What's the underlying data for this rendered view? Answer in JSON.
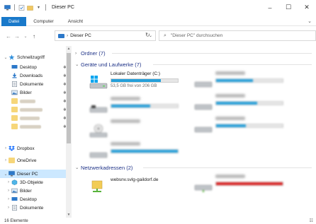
{
  "window": {
    "title": "Dieser PC",
    "controls": {
      "minimize": "–",
      "maximize": "☐",
      "close": "✕"
    }
  },
  "ribbon": {
    "tabs": [
      "Datei",
      "Computer",
      "Ansicht"
    ],
    "expand": "⌄"
  },
  "nav": {
    "back": "←",
    "forward": "→",
    "recent": "⌄",
    "up": "↑",
    "address": "Dieser PC",
    "address_sep": "›",
    "address_dropdown": "⌄",
    "refresh": "↻",
    "search_placeholder": "\"Dieser PC\" durchsuchen"
  },
  "sidebar": {
    "quick_access": "Schnellzugriff",
    "items": [
      {
        "label": "Desktop",
        "icon": "desktop-icon",
        "pinned": true
      },
      {
        "label": "Downloads",
        "icon": "download-icon",
        "pinned": true
      },
      {
        "label": "Dokumente",
        "icon": "documents-icon",
        "pinned": true
      },
      {
        "label": "Bilder",
        "icon": "pictures-icon",
        "pinned": true
      }
    ],
    "blurred_folder_count": 4,
    "dropbox": "Dropbox",
    "onedrive": "OneDrive",
    "this_pc": "Dieser PC",
    "pc_children": [
      {
        "label": "3D-Objekte",
        "icon": "3d-objects-icon"
      },
      {
        "label": "Bilder",
        "icon": "pictures-icon"
      },
      {
        "label": "Desktop",
        "icon": "desktop-icon"
      },
      {
        "label": "Dokumente",
        "icon": "documents-icon"
      }
    ]
  },
  "content": {
    "groups": {
      "folders": "Ordner (7)",
      "devices": "Geräte und Laufwerke (7)",
      "network": "Netzwerkadressen (2)"
    },
    "local_drive": {
      "name": "Lokaler Datenträger (C:)",
      "info": "53,5 GB frei von 206 GB",
      "used_fraction": 0.74
    },
    "network_location": {
      "name": "websnv.svlg-gaildorf.de"
    },
    "accent": "#26a0da",
    "danger": "#da2626"
  },
  "status": {
    "count": "16 Elemente"
  }
}
